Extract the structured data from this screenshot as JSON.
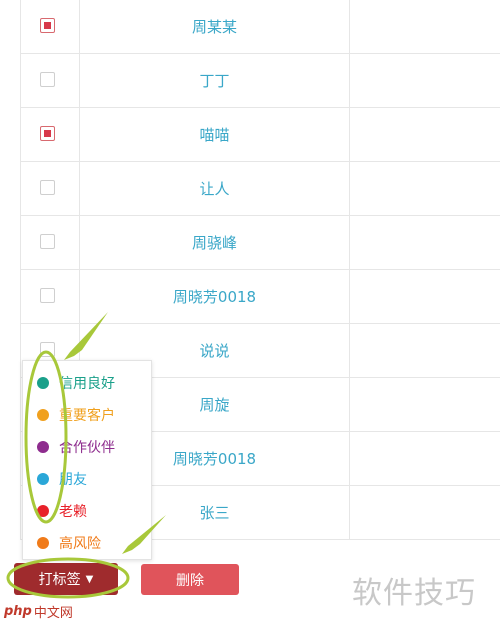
{
  "table": {
    "rows": [
      {
        "name": "周某某",
        "checked": true
      },
      {
        "name": "丁丁",
        "checked": false
      },
      {
        "name": "喵喵",
        "checked": true
      },
      {
        "name": "让人",
        "checked": false
      },
      {
        "name": "周骁峰",
        "checked": false
      },
      {
        "name": "周晓芳0018",
        "checked": false
      },
      {
        "name": "说说",
        "checked": false
      },
      {
        "name": "周旋",
        "checked": false
      },
      {
        "name": "周晓芳0018",
        "checked": false
      },
      {
        "name": "张三",
        "checked": false
      }
    ]
  },
  "tag_menu": {
    "items": [
      {
        "label": "信用良好",
        "color": "#1aa08a"
      },
      {
        "label": "重要客户",
        "color": "#f0a01e"
      },
      {
        "label": "合作伙伴",
        "color": "#8e2c8e"
      },
      {
        "label": "朋友",
        "color": "#2aa7d8"
      },
      {
        "label": "老赖",
        "color": "#e8212a"
      },
      {
        "label": "高风险",
        "color": "#f07b1a"
      }
    ]
  },
  "actions": {
    "tag_label": "打标签",
    "delete_label": "删除"
  },
  "watermark": {
    "right": "软件技巧",
    "left_logo": "php",
    "left_text": "中文网"
  }
}
